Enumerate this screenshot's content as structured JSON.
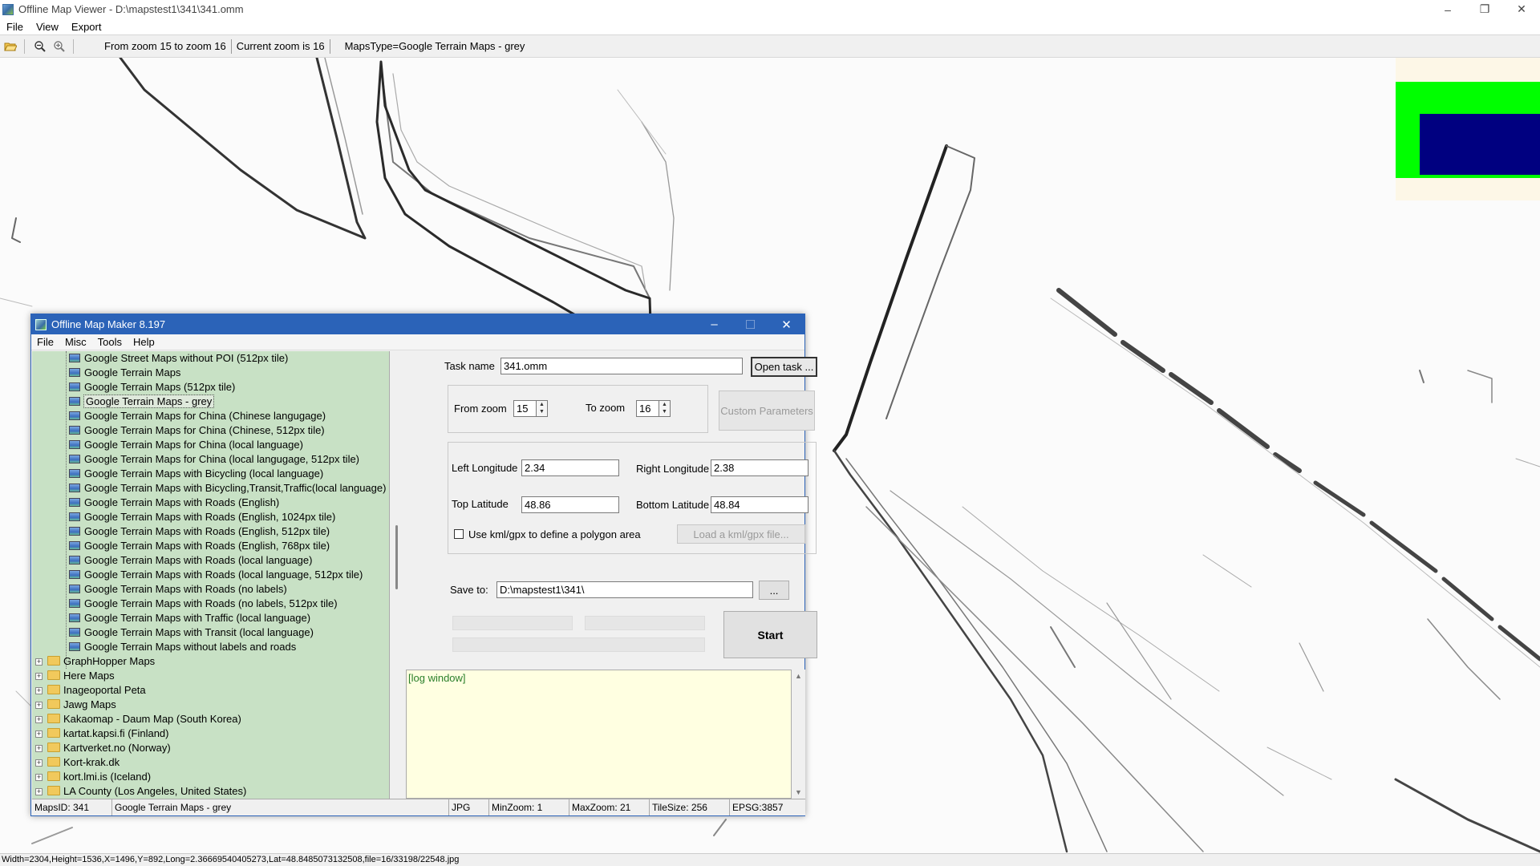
{
  "window": {
    "title": "Offline Map Viewer - D:\\mapstest1\\341\\341.omm",
    "controls": [
      "–",
      "❐",
      "✕"
    ]
  },
  "menu": [
    "File",
    "View",
    "Export"
  ],
  "toolbar": {
    "zoom_range": "From zoom 15 to zoom 16",
    "current_zoom": "Current zoom is 16",
    "maps_type": "MapsType=Google Terrain Maps - grey"
  },
  "status_main": "Width=2304,Height=1536,X=1496,Y=892,Long=2.36669540405273,Lat=48.8485073132508,file=16/33198/22548.jpg",
  "dialog": {
    "title": "Offline Map Maker 8.197",
    "controls": [
      "–",
      "☐",
      "✕"
    ],
    "menu": [
      "File",
      "Misc",
      "Tools",
      "Help"
    ],
    "tree_leaves": [
      "Google Street Maps without POI (512px tile)",
      "Google Terrain Maps",
      "Google Terrain Maps (512px tile)",
      "Google Terrain Maps - grey",
      "Google Terrain Maps for China (Chinese langugage)",
      "Google Terrain Maps for China (Chinese, 512px tile)",
      "Google Terrain Maps for China (local language)",
      "Google Terrain Maps for China (local langugage, 512px tile)",
      "Google Terrain Maps with Bicycling (local language)",
      "Google Terrain Maps with Bicycling,Transit,Traffic(local language)",
      "Google Terrain Maps with Roads (English)",
      "Google Terrain Maps with Roads (English, 1024px tile)",
      "Google Terrain Maps with Roads (English, 512px tile)",
      "Google Terrain Maps with Roads (English, 768px tile)",
      "Google Terrain Maps with Roads (local language)",
      "Google Terrain Maps with Roads (local language, 512px tile)",
      "Google Terrain Maps with Roads (no labels)",
      "Google Terrain Maps with Roads (no labels, 512px tile)",
      "Google Terrain Maps with Traffic (local language)",
      "Google Terrain Maps with Transit (local language)",
      "Google Terrain Maps without labels and roads"
    ],
    "selected_leaf": 3,
    "tree_folders": [
      "GraphHopper Maps",
      "Here Maps",
      "Inageoportal Peta",
      "Jawg Maps",
      "Kakaomap - Daum Map (South Korea)",
      "kartat.kapsi.fi (Finland)",
      "Kartverket.no (Norway)",
      "Kort-krak.dk",
      "kort.lmi.is (Iceland)",
      "LA County (Los Angeles, United States)"
    ],
    "task_name_label": "Task name",
    "task_name_value": "341.omm",
    "open_task": "Open task ...",
    "from_zoom_label": "From zoom",
    "from_zoom_value": "15",
    "to_zoom_label": "To zoom",
    "to_zoom_value": "16",
    "custom_params": "Custom Parameters",
    "left_lon_label": "Left Longitude",
    "left_lon_value": "2.34",
    "right_lon_label": "Right Longitude",
    "right_lon_value": "2.38",
    "top_lat_label": "Top Latitude",
    "top_lat_value": "48.86",
    "bottom_lat_label": "Bottom Latitude",
    "bottom_lat_value": "48.84",
    "kml_label": "Use kml/gpx to define a polygon area",
    "load_kml": "Load a kml/gpx file...",
    "save_to_label": "Save to:",
    "save_to_value": "D:\\mapstest1\\341\\",
    "browse": "...",
    "start": "Start",
    "log_text": "[log window]",
    "status": {
      "maps_id": "MapsID: 341",
      "maps_name": "Google Terrain Maps - grey",
      "format": "JPG",
      "min_zoom": "MinZoom: 1",
      "max_zoom": "MaxZoom: 21",
      "tile_size": "TileSize: 256",
      "epsg": "EPSG:3857"
    }
  },
  "colors": {
    "dialog_titlebar": "#2b63b8",
    "tree_bg": "#c8e1c5",
    "log_bg": "#ffffe1",
    "overview_green": "#00ff00",
    "overview_navy": "#000080"
  }
}
